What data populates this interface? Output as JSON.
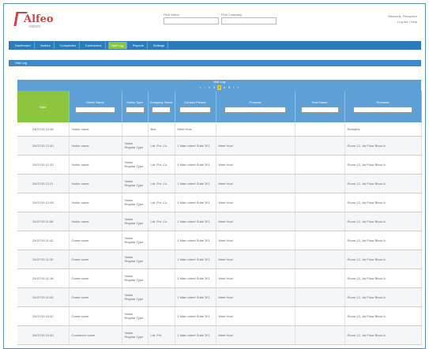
{
  "brand": {
    "name": "Alfeo",
    "tagline": "visitors"
  },
  "search": [
    {
      "label": "Find Visitor",
      "placeholder": ""
    },
    {
      "label": "Find Company",
      "placeholder": ""
    }
  ],
  "user": {
    "line1": "Welcome, Reception",
    "line2": "Log out  |  Help"
  },
  "nav": {
    "items": [
      {
        "label": "Dashboard",
        "active": false
      },
      {
        "label": "Visitors",
        "active": false
      },
      {
        "label": "Companies",
        "active": false
      },
      {
        "label": "Contractors",
        "active": false
      },
      {
        "label": "Visit Log",
        "active": true
      },
      {
        "label": "Reports",
        "active": false
      },
      {
        "label": "Settings",
        "active": false
      }
    ]
  },
  "subbar": {
    "label": "Visit Log"
  },
  "grid": {
    "title": "Visit Log",
    "pager": [
      "«",
      "‹",
      "1",
      "2",
      "3",
      "4",
      "5",
      "›",
      "»"
    ],
    "pager_current": "3",
    "columns": [
      "Date",
      "Visitor Name",
      "Visitor Type",
      "Company Name",
      "Contact Person",
      "Purpose",
      "Host Name",
      "Remarks"
    ],
    "rows": [
      [
        "24/07/15 12:46",
        "Visitor name",
        "",
        "Bus",
        "Meet Host",
        "",
        "",
        "Remarks"
      ],
      [
        "24/07/15 12:40",
        "Visitor name",
        "Visitor Regular Type",
        "Ltd. Pvt. Co.",
        "1 Main street Suite 201",
        "Meet Host",
        "",
        "Room 12, 1st Floor Block A"
      ],
      [
        "24/07/15 12:33",
        "Visitor name",
        "Visitor Regular Type",
        "Ltd. Pvt. Co.",
        "1 Main street Suite 201",
        "Meet Host",
        "",
        "Room 12, 1st Floor Block A"
      ],
      [
        "24/07/15 12:21",
        "Visitor name",
        "Visitor Regular Type",
        "Ltd. Pvt. Co.",
        "1 Main street Suite 201",
        "Meet Host",
        "",
        "Room 12, 1st Floor Block A"
      ],
      [
        "24/07/15 12:08",
        "Visitor name",
        "Visitor Regular Type",
        "Ltd. Pvt. Co.",
        "1 Main street Suite 201",
        "Meet Host",
        "",
        "Room 12, 1st Floor Block A"
      ],
      [
        "24/07/15 11:56",
        "Visitor name",
        "Visitor Regular Type",
        "Ltd. Pvt. Co.",
        "1 Main street Suite 201",
        "Meet Host",
        "",
        "Room 12, 1st Floor Block A"
      ],
      [
        "24/07/15 11:42",
        "Guest name",
        "Visitor Regular Type",
        "",
        "1 Main street Suite 201",
        "Meet Host",
        "",
        "Room 12, 1st Floor Block A"
      ],
      [
        "24/07/15 11:30",
        "Guest name",
        "Visitor Regular Type",
        "",
        "1 Main street Suite 201",
        "Meet Host",
        "",
        "Room 12, 1st Floor Block A"
      ],
      [
        "24/07/15 11:18",
        "Guest name",
        "Visitor Regular Type",
        "",
        "1 Main street Suite 201",
        "Meet Host",
        "",
        "Room 12, 1st Floor Block A"
      ],
      [
        "24/07/15 11:05",
        "Guest name",
        "Visitor Regular Type",
        "",
        "1 Main street Suite 201",
        "Meet Host",
        "",
        "Room 12, 1st Floor Block A"
      ],
      [
        "24/07/15 10:52",
        "Guest name",
        "Visitor Regular Type",
        "",
        "1 Main street Suite 201",
        "Meet Host",
        "",
        "Room 12, 1st Floor Block A"
      ],
      [
        "24/07/15 10:40",
        "Contractor name",
        "Visitor Regular Type",
        "Ltd. Pvt.",
        "1 Main street Suite 201",
        "Meet Host",
        "",
        "Room 12, 1st Floor Block A"
      ]
    ]
  },
  "colors": {
    "brand": "#cc4444",
    "nav": "#2b7bbd",
    "active": "#8cc63f",
    "grid_header": "#5e9fd6",
    "pager_current": "#f5d000"
  }
}
